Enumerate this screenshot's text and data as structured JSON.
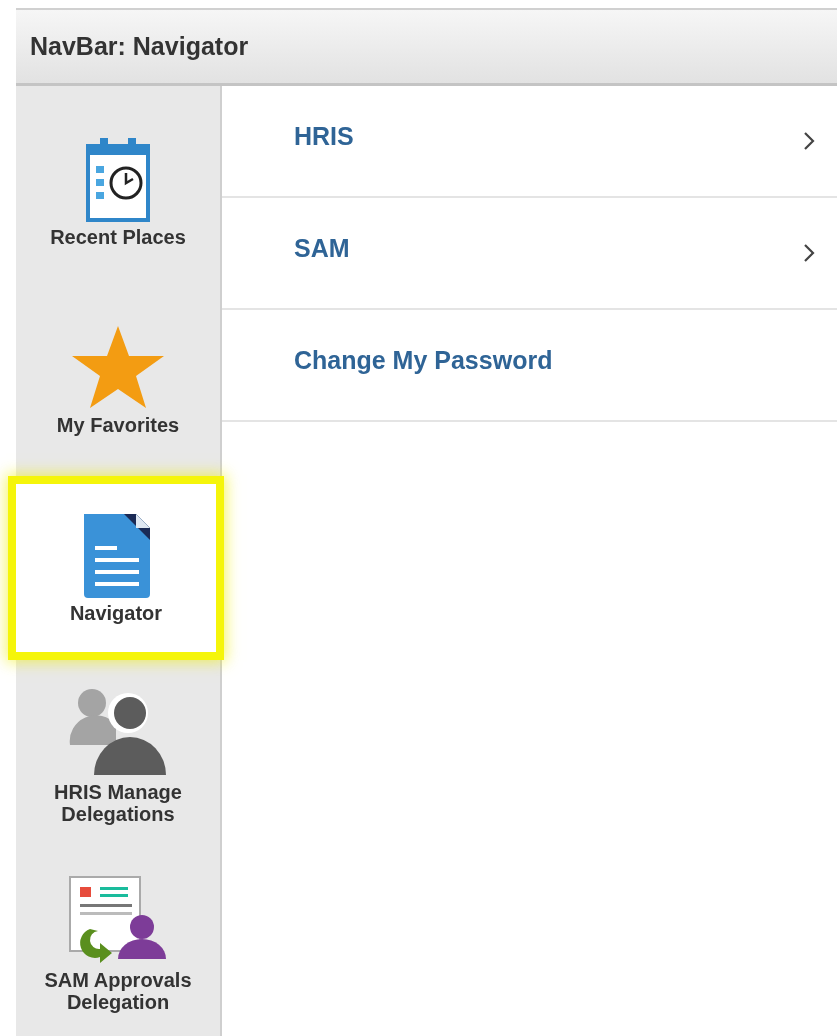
{
  "header": {
    "title": "NavBar: Navigator"
  },
  "sidebar": {
    "items": [
      {
        "kind": "calendar",
        "label": "Recent Places",
        "selected": false
      },
      {
        "kind": "star",
        "label": "My Favorites",
        "selected": false
      },
      {
        "kind": "document",
        "label": "Navigator",
        "selected": true
      },
      {
        "kind": "people",
        "label": "HRIS Manage Delegations",
        "selected": false
      },
      {
        "kind": "approval",
        "label": "SAM Approvals Delegation",
        "selected": false
      }
    ]
  },
  "menu": {
    "items": [
      {
        "label": "HRIS",
        "has_submenu": true
      },
      {
        "label": "SAM",
        "has_submenu": true
      },
      {
        "label": "Change My Password",
        "has_submenu": false
      }
    ]
  }
}
